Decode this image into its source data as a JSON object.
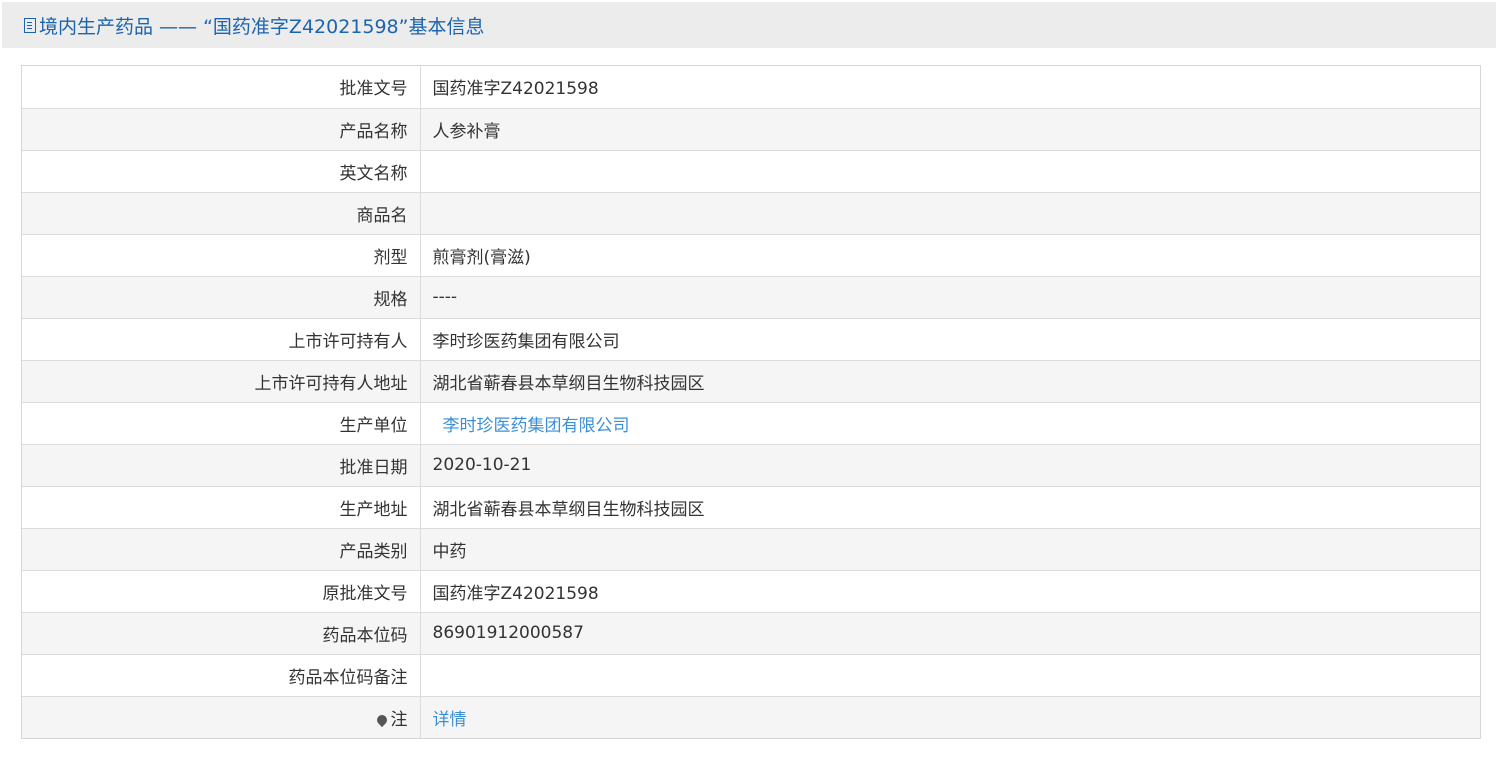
{
  "header": {
    "title": "境内生产药品 —— “国药准字Z42021598”基本信息"
  },
  "rows": [
    {
      "label": "批准文号",
      "value": "国药准字Z42021598"
    },
    {
      "label": "产品名称",
      "value": "人参补膏"
    },
    {
      "label": "英文名称",
      "value": ""
    },
    {
      "label": "商品名",
      "value": ""
    },
    {
      "label": "剂型",
      "value": "煎膏剂(膏滋)"
    },
    {
      "label": "规格",
      "value": "----"
    },
    {
      "label": "上市许可持有人",
      "value": "李时珍医药集团有限公司"
    },
    {
      "label": "上市许可持有人地址",
      "value": "湖北省蕲春县本草纲目生物科技园区"
    },
    {
      "label": "生产单位",
      "value": "李时珍医药集团有限公司"
    },
    {
      "label": "批准日期",
      "value": "2020-10-21"
    },
    {
      "label": "生产地址",
      "value": "湖北省蕲春县本草纲目生物科技园区"
    },
    {
      "label": "产品类别",
      "value": "中药"
    },
    {
      "label": "原批准文号",
      "value": "国药准字Z42021598"
    },
    {
      "label": "药品本位码",
      "value": "86901912000587"
    },
    {
      "label": "药品本位码备注",
      "value": ""
    },
    {
      "label": "注",
      "value": "详情"
    }
  ],
  "icons": {
    "header_icon": "document-icon",
    "note_icon": "pin-icon"
  },
  "colors": {
    "header_text": "#1c64ad",
    "link": "#3b8fd6",
    "stripe": "#f5f5f5"
  }
}
